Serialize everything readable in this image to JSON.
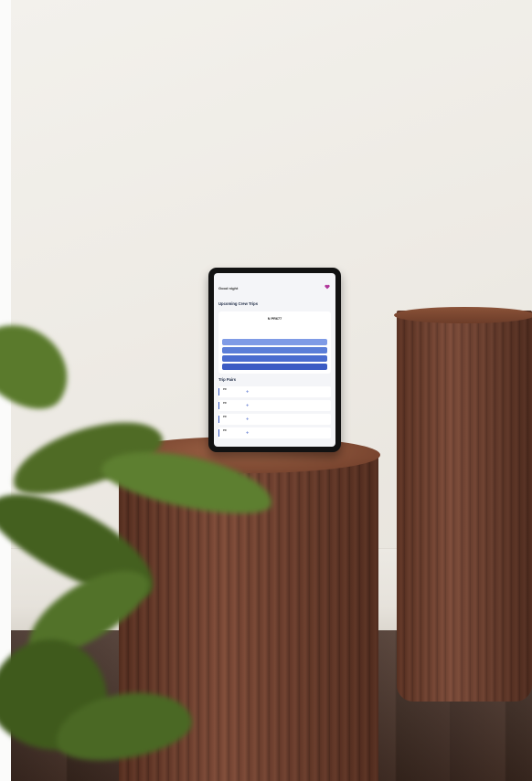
{
  "colors": {
    "wall": "#f0ede7",
    "wood": "#6e3c29",
    "floor": "#3f2b22",
    "tablet_bezel": "#121212",
    "screen_bg": "#f4f5f8",
    "accent_blue": "#3b5bc4",
    "plant_green": "#4f6b2a"
  },
  "tablet_screen": {
    "greeting": "Good night",
    "upcoming_title": "Upcoming Crew Trips",
    "featured_trip": {
      "flight": "N PR677"
    },
    "trip_rows": [
      {
        "code": "PR"
      },
      {
        "code": "PR"
      },
      {
        "code": "PR"
      },
      {
        "code": "PR"
      }
    ],
    "next_section_title": "Trip Pairs",
    "logo_icon": "heart-logo-icon"
  }
}
